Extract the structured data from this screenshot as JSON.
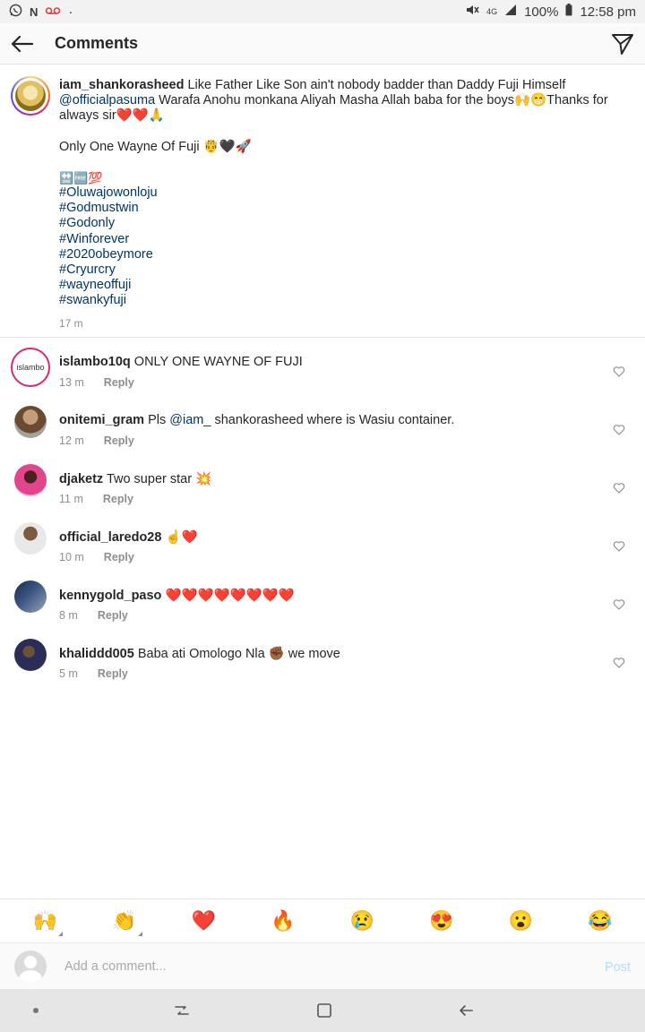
{
  "status_bar": {
    "left_icons": [
      "whatsapp-icon",
      "n-icon",
      "voicemail-icon",
      "dot"
    ],
    "network": "4G",
    "battery": "100%",
    "time": "12:58 pm"
  },
  "header": {
    "title": "Comments"
  },
  "caption": {
    "username": "iam_shankorasheed",
    "text_1": " Like Father Like Son ain't nobody badder than Daddy Fuji Himself ",
    "mention": "@officialpasuma",
    "text_2": " Warafa Anohu monkana Aliyah Masha Allah baba for the boys🙌😁Thanks for always sir❤️❤️🙏",
    "line_2": "Only One Wayne Of Fuji 🤴🖤🚀",
    "emoji_line": "🔛🆓💯",
    "hashtags": [
      "#Oluwajowonloju",
      "#Godmustwin",
      "#Godonly",
      "#Winforever",
      "#2020obeymore",
      "#Cryurcry",
      "#wayneoffuji",
      "#swankyfuji"
    ],
    "time": "17 m"
  },
  "comments": [
    {
      "username": "islambo10q",
      "text": " ONLY ONE WAYNE OF FUJI",
      "time": "13 m",
      "reply": "Reply",
      "avatar_label": "islambo"
    },
    {
      "username": "onitemi_gram",
      "text_before": " Pls ",
      "mention": "@iam_",
      "text_after": " shankorasheed where is Wasiu container.",
      "time": "12 m",
      "reply": "Reply"
    },
    {
      "username": "djaketz",
      "text": " Two super star 💥",
      "time": "11 m",
      "reply": "Reply"
    },
    {
      "username": "official_laredo28",
      "text": " ☝️❤️",
      "time": "10 m",
      "reply": "Reply"
    },
    {
      "username": "kennygold_paso",
      "text": " ❤️❤️❤️❤️❤️❤️❤️❤️",
      "time": "8 m",
      "reply": "Reply"
    },
    {
      "username": "khaliddd005",
      "text": " Baba ati Omologo Nla ✊🏾 we move",
      "time": "5 m",
      "reply": "Reply"
    }
  ],
  "emoji_bar": [
    "🙌",
    "👏",
    "❤️",
    "🔥",
    "😢",
    "😍",
    "😮",
    "😂"
  ],
  "composer": {
    "placeholder": "Add a comment...",
    "post_label": "Post"
  },
  "colors": {
    "link": "#003569",
    "meta": "#8e8e8e",
    "post_disabled": "#b3dbff"
  }
}
